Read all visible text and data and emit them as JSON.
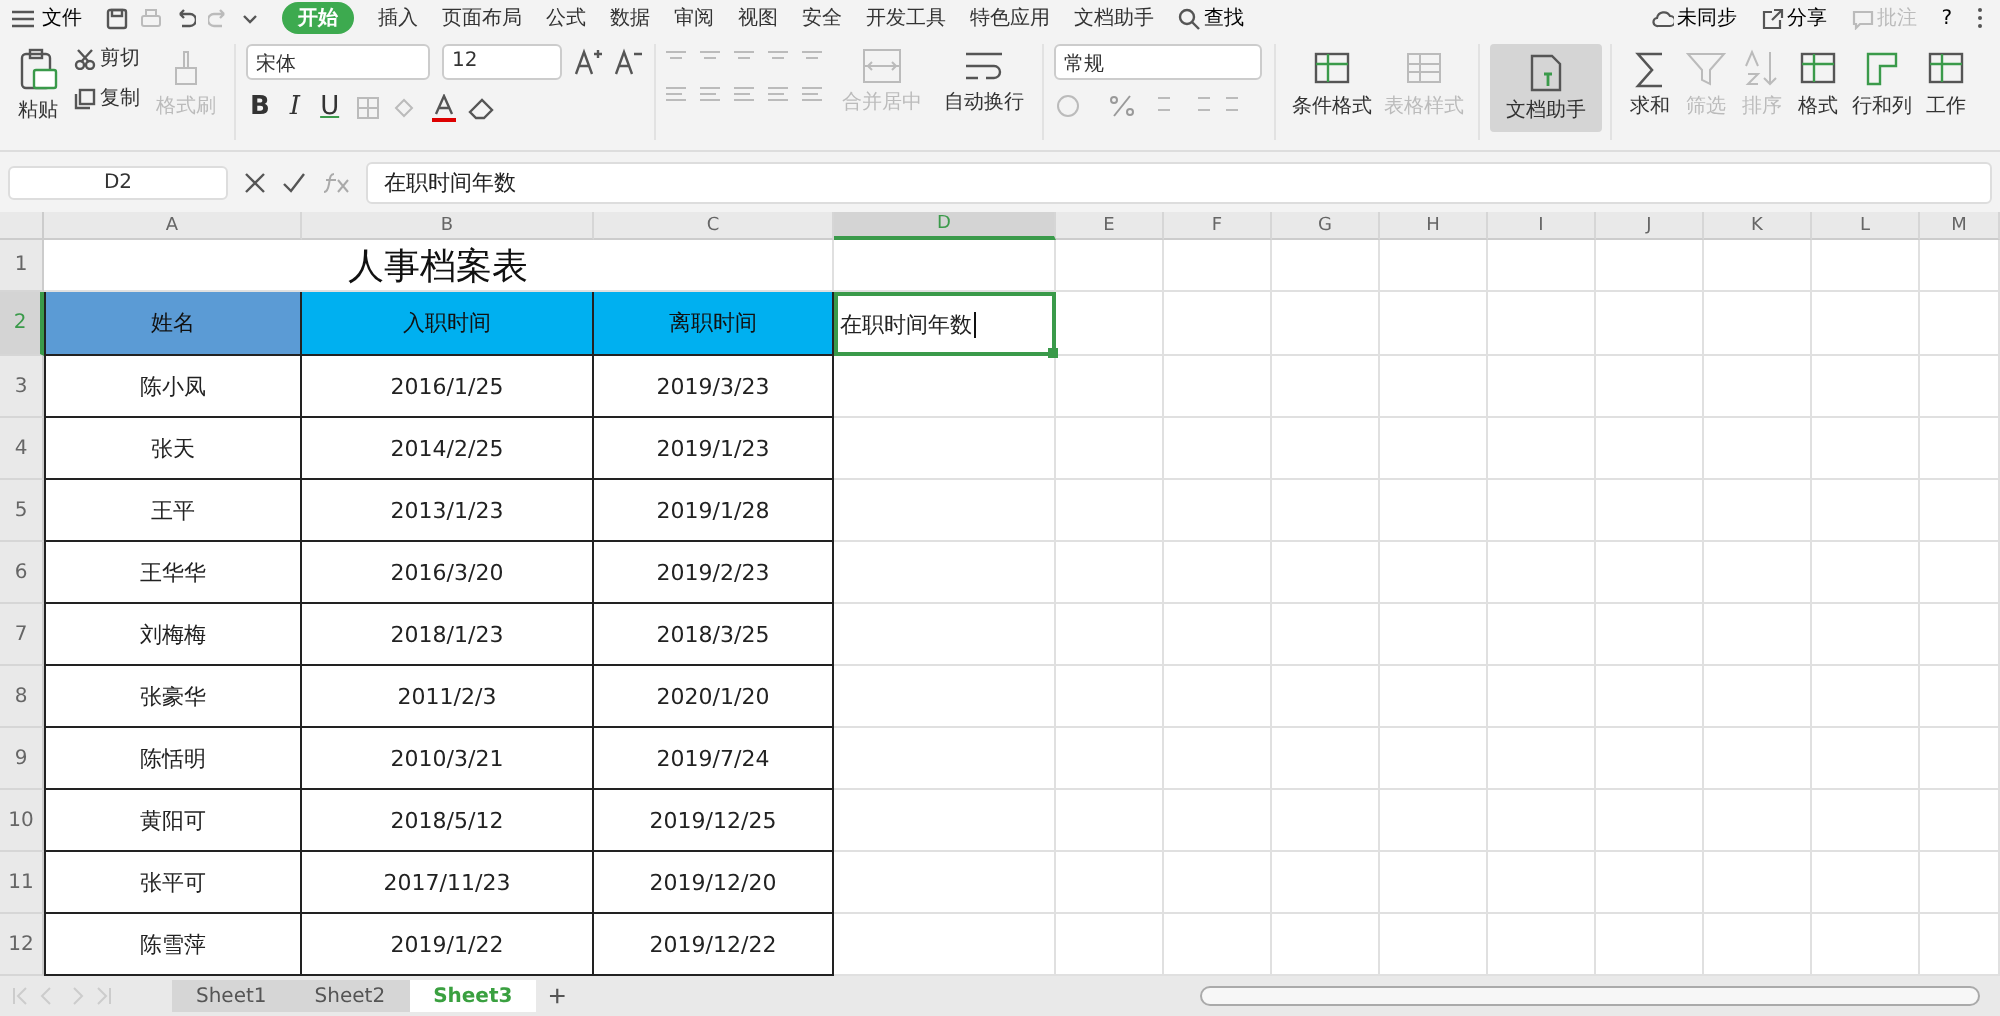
{
  "menu_bar": {
    "file": "文件",
    "tabs": [
      {
        "label": "开始",
        "selected": true
      },
      {
        "label": "插入",
        "selected": false
      },
      {
        "label": "页面布局",
        "selected": false
      },
      {
        "label": "公式",
        "selected": false
      },
      {
        "label": "数据",
        "selected": false
      },
      {
        "label": "审阅",
        "selected": false
      },
      {
        "label": "视图",
        "selected": false
      },
      {
        "label": "安全",
        "selected": false
      },
      {
        "label": "开发工具",
        "selected": false
      },
      {
        "label": "特色应用",
        "selected": false
      },
      {
        "label": "文档助手",
        "selected": false
      }
    ],
    "search": "查找",
    "actions": [
      {
        "label": "未同步",
        "disabled": false
      },
      {
        "label": "分享",
        "disabled": false
      },
      {
        "label": "批注",
        "disabled": true
      }
    ],
    "help": "?"
  },
  "ribbon": {
    "paste": "粘贴",
    "cut": "剪切",
    "copy": "复制",
    "format_painter": {
      "label": "格式刷",
      "disabled": true
    },
    "font_name": "宋体",
    "font_size": "12",
    "styles": [
      "B",
      "I",
      "U"
    ],
    "merge": {
      "label": "合并居中",
      "disabled": true
    },
    "wrap": {
      "label": "自动换行",
      "disabled": false
    },
    "number_format": "常规",
    "tools": [
      {
        "kind": "table",
        "label": "条件格式",
        "disabled": false,
        "selected": false
      },
      {
        "kind": "style",
        "label": "表格样式",
        "disabled": true,
        "selected": false
      },
      {
        "kind": "doc",
        "label": "文档助手",
        "disabled": false,
        "selected": true
      },
      {
        "kind": "sum",
        "label": "求和",
        "disabled": false,
        "selected": false
      },
      {
        "kind": "filter",
        "label": "筛选",
        "disabled": true,
        "selected": false
      },
      {
        "kind": "sort",
        "label": "排序",
        "disabled": true,
        "selected": false
      },
      {
        "kind": "table",
        "label": "格式",
        "disabled": false,
        "selected": false
      },
      {
        "kind": "rows",
        "label": "行和列",
        "disabled": false,
        "selected": false
      },
      {
        "kind": "table",
        "label": "工作",
        "disabled": false,
        "selected": false
      }
    ]
  },
  "formula_bar": {
    "name_box": "D2",
    "formula": "在职时间年数"
  },
  "columns": [
    {
      "label": "A",
      "selected": false
    },
    {
      "label": "B",
      "selected": false
    },
    {
      "label": "C",
      "selected": false
    },
    {
      "label": "D",
      "selected": true
    },
    {
      "label": "E",
      "selected": false
    },
    {
      "label": "F",
      "selected": false
    },
    {
      "label": "G",
      "selected": false
    },
    {
      "label": "H",
      "selected": false
    },
    {
      "label": "I",
      "selected": false
    },
    {
      "label": "J",
      "selected": false
    },
    {
      "label": "K",
      "selected": false
    },
    {
      "label": "L",
      "selected": false
    },
    {
      "label": "M",
      "selected": false
    }
  ],
  "rows": [
    {
      "label": "1",
      "selected": false
    },
    {
      "label": "2",
      "selected": true
    },
    {
      "label": "3",
      "selected": false
    },
    {
      "label": "4",
      "selected": false
    },
    {
      "label": "5",
      "selected": false
    },
    {
      "label": "6",
      "selected": false
    },
    {
      "label": "7",
      "selected": false
    },
    {
      "label": "8",
      "selected": false
    },
    {
      "label": "9",
      "selected": false
    },
    {
      "label": "10",
      "selected": false
    },
    {
      "label": "11",
      "selected": false
    },
    {
      "label": "12",
      "selected": false
    }
  ],
  "sheet": {
    "title": "人事档案表",
    "headers": [
      {
        "label": "姓名",
        "color": "#5b9bd5"
      },
      {
        "label": "入职时间",
        "color": "#00b0f0"
      },
      {
        "label": "离职时间",
        "color": "#00b0f0"
      }
    ],
    "records": [
      [
        "陈小凤",
        "2016/1/25",
        "2019/3/23"
      ],
      [
        "张天",
        "2014/2/25",
        "2019/1/23"
      ],
      [
        "王平",
        "2013/1/23",
        "2019/1/28"
      ],
      [
        "王华华",
        "2016/3/20",
        "2019/2/23"
      ],
      [
        "刘梅梅",
        "2018/1/23",
        "2018/3/25"
      ],
      [
        "张豪华",
        "2011/2/3",
        "2020/1/20"
      ],
      [
        "陈恬明",
        "2010/3/21",
        "2019/7/24"
      ],
      [
        "黄阳可",
        "2018/5/12",
        "2019/12/25"
      ],
      [
        "张平可",
        "2017/11/23",
        "2019/12/20"
      ],
      [
        "陈雪萍",
        "2019/1/22",
        "2019/12/22"
      ]
    ],
    "active_cell": "在职时间年数"
  },
  "sheet_tabs": [
    {
      "label": "Sheet1",
      "selected": false
    },
    {
      "label": "Sheet2",
      "selected": false
    },
    {
      "label": "Sheet3",
      "selected": true
    }
  ],
  "add_sheet": "+"
}
